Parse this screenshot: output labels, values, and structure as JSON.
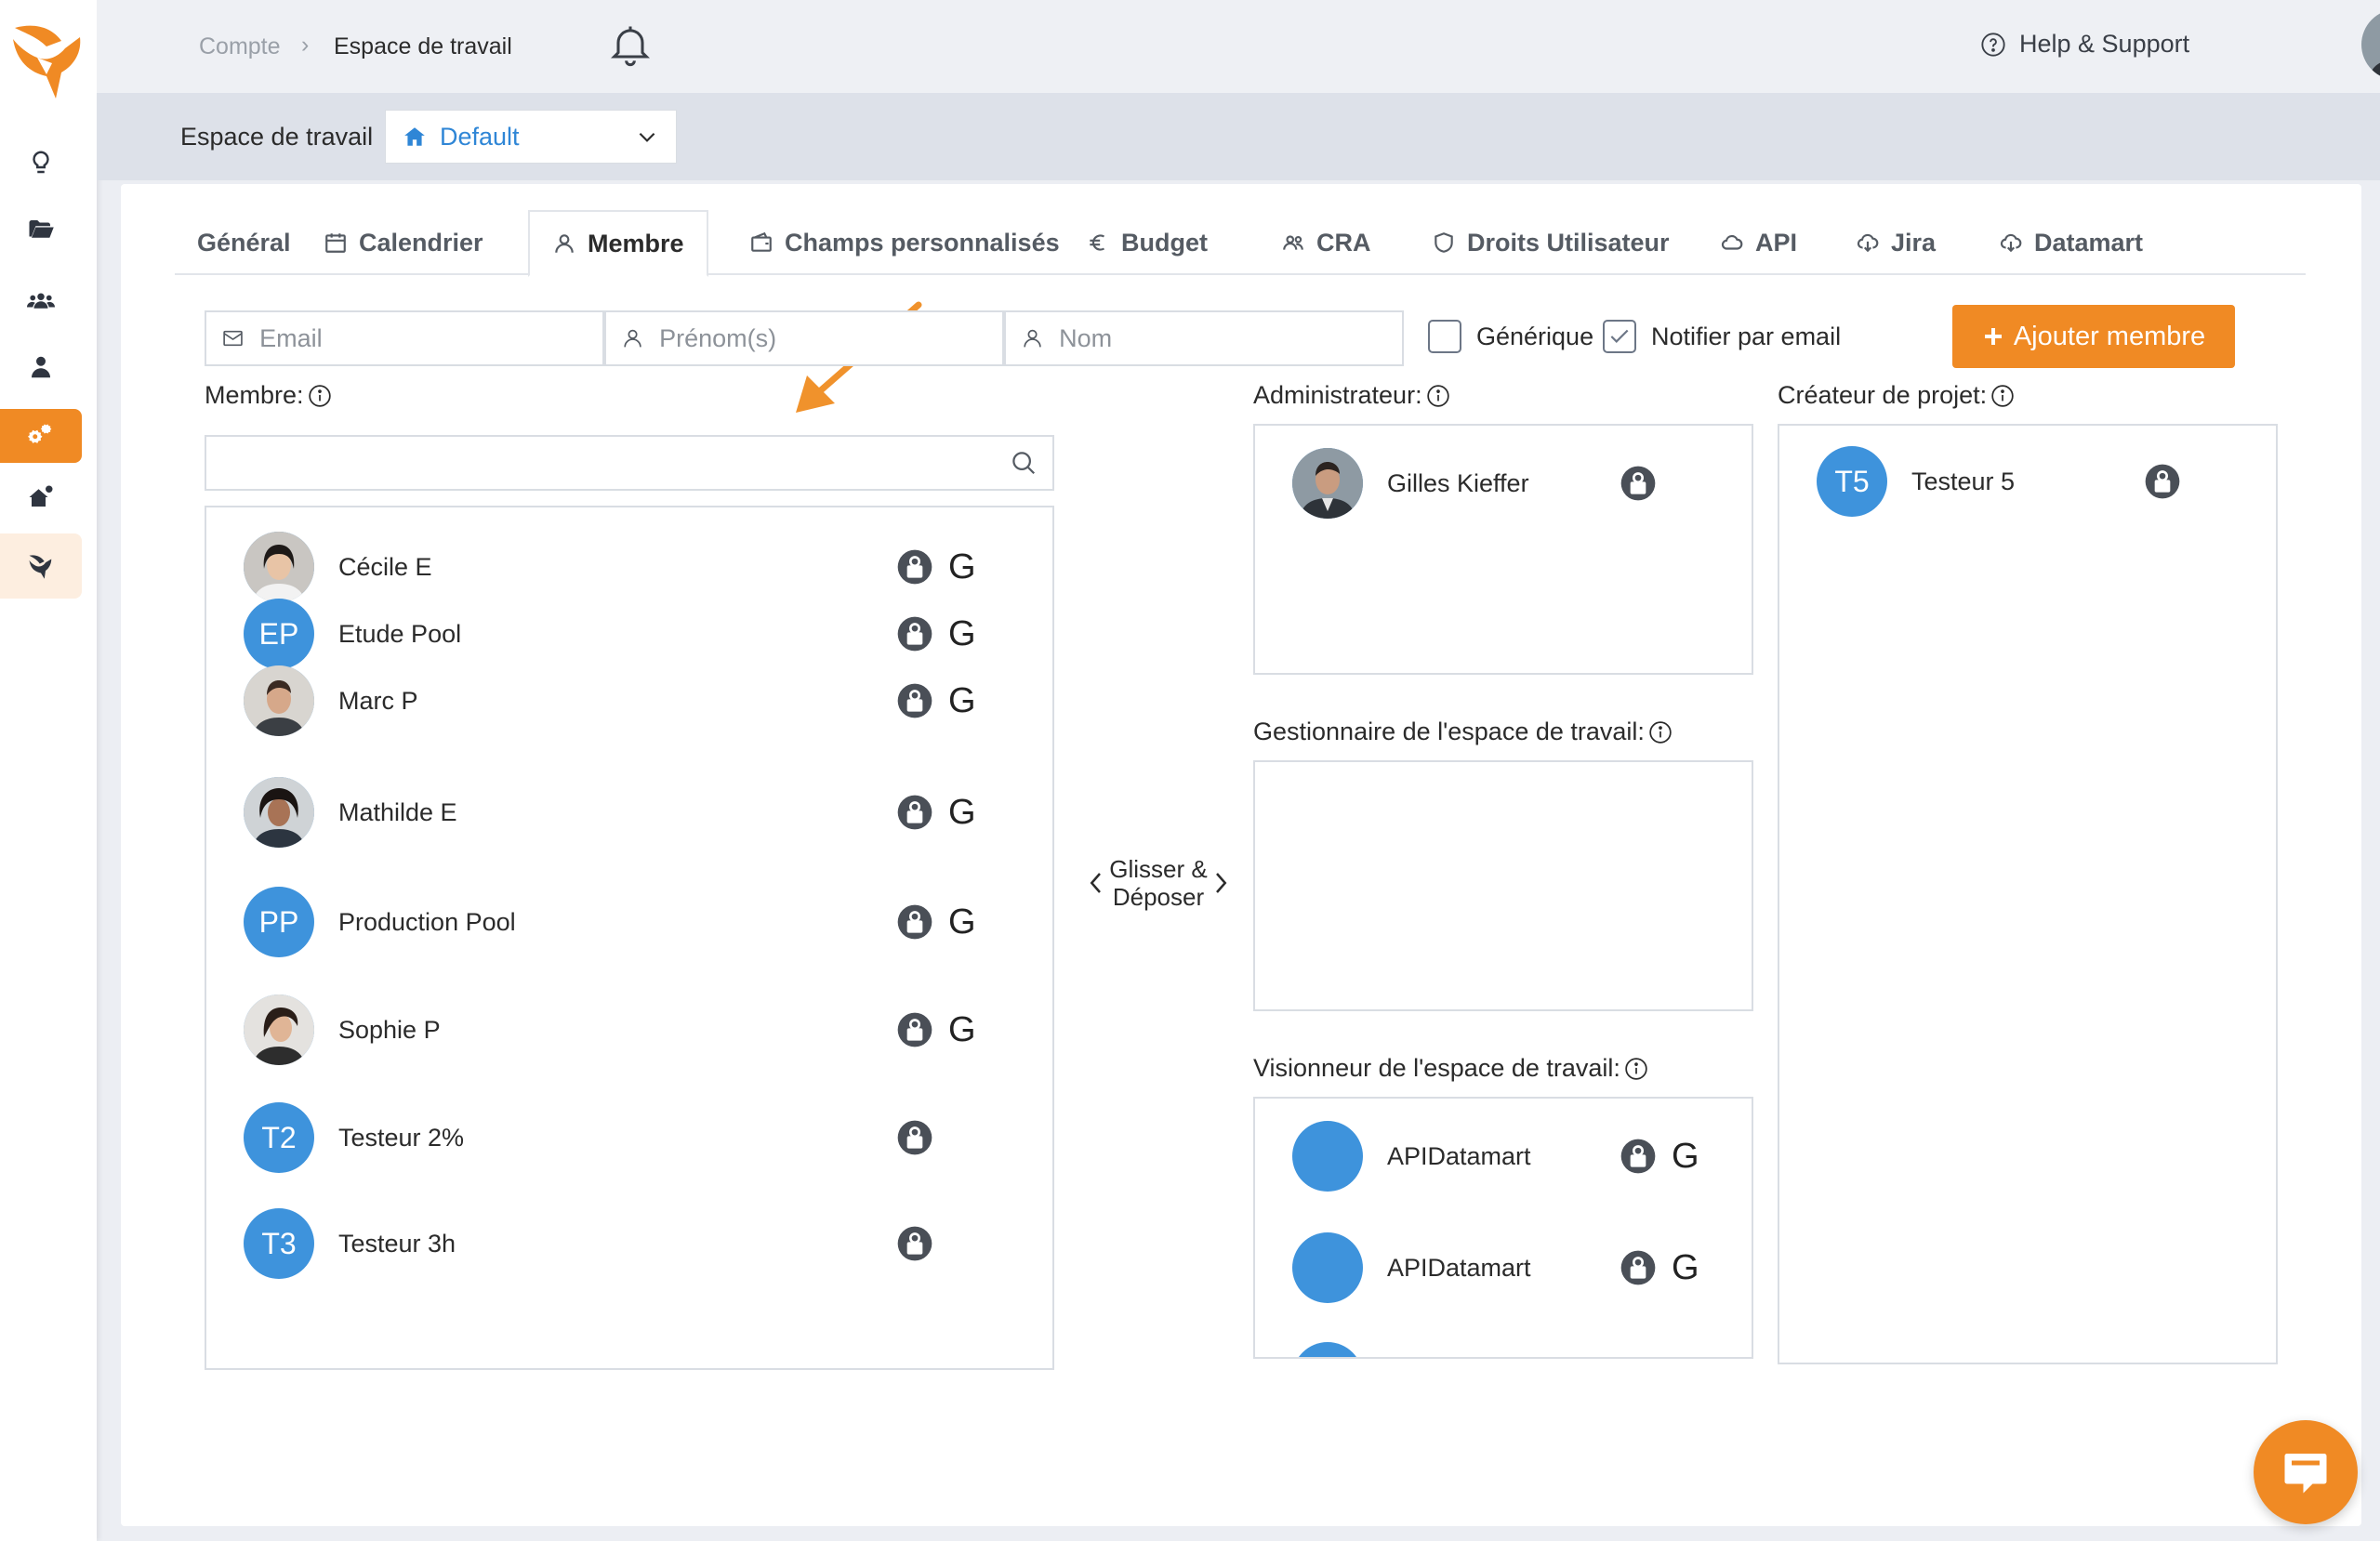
{
  "breadcrumb": {
    "parent": "Compte",
    "separator": "›",
    "current": "Espace de travail"
  },
  "header": {
    "help_label": "Help & Support"
  },
  "workspace": {
    "label": "Espace de travail",
    "selected": "Default"
  },
  "tabs": [
    {
      "label": "Général"
    },
    {
      "label": "Calendrier"
    },
    {
      "label": "Membre"
    },
    {
      "label": "Champs personnalisés"
    },
    {
      "label": "Budget"
    },
    {
      "label": "CRA"
    },
    {
      "label": "Droits Utilisateur"
    },
    {
      "label": "API"
    },
    {
      "label": "Jira"
    },
    {
      "label": "Datamart"
    }
  ],
  "form": {
    "email_placeholder": "Email",
    "firstname_placeholder": "Prénom(s)",
    "lastname_placeholder": "Nom",
    "generic_label": "Générique",
    "notify_label": "Notifier par email",
    "add_label": "Ajouter membre"
  },
  "sections": {
    "members": "Membre:",
    "admin": "Administrateur:",
    "manager": "Gestionnaire de l'espace de travail:",
    "viewer": "Visionneur de l'espace de travail:",
    "creator": "Créateur de projet:",
    "drag_line1": "Glisser &",
    "drag_line2": "Déposer"
  },
  "members": [
    {
      "name": "Cécile E",
      "initials": "",
      "generic": "G"
    },
    {
      "name": "Etude Pool",
      "initials": "EP",
      "generic": "G"
    },
    {
      "name": "Marc P",
      "initials": "",
      "generic": "G"
    },
    {
      "name": "Mathilde E",
      "initials": "",
      "generic": "G"
    },
    {
      "name": "Production Pool",
      "initials": "PP",
      "generic": "G"
    },
    {
      "name": "Sophie P",
      "initials": "",
      "generic": "G"
    },
    {
      "name": "Testeur 2%",
      "initials": "T2",
      "generic": ""
    },
    {
      "name": "Testeur 3h",
      "initials": "T3",
      "generic": ""
    }
  ],
  "admins": [
    {
      "name": "Gilles Kieffer"
    }
  ],
  "viewers": [
    {
      "name": "APIDatamart",
      "generic": "G"
    },
    {
      "name": "APIDatamart",
      "generic": "G"
    }
  ],
  "creators": [
    {
      "name": "Testeur 5",
      "initials": "T5"
    }
  ],
  "colors": {
    "accent": "#f08a24",
    "link": "#2f86d6",
    "avatar": "#3e93dc"
  }
}
